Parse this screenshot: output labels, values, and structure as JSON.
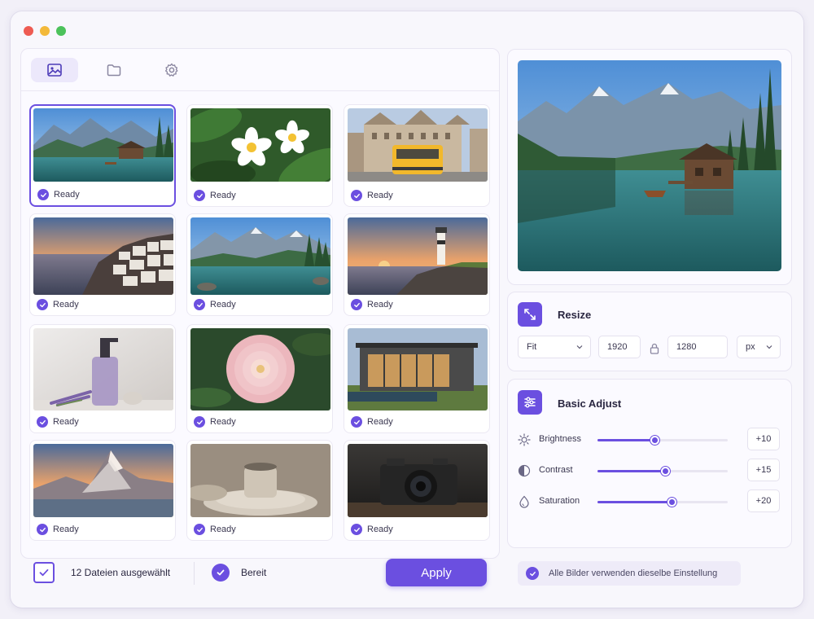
{
  "window": {
    "controls": [
      "close",
      "minimize",
      "maximize"
    ]
  },
  "tabs": [
    {
      "name": "image-icon",
      "active": true
    },
    {
      "name": "folder-icon",
      "active": false
    },
    {
      "name": "gear-icon",
      "active": false
    }
  ],
  "gallery": {
    "items": [
      {
        "scene": "mountain-lake-cabin",
        "status": "Ready",
        "selected": true
      },
      {
        "scene": "frangipani-flowers",
        "status": "Ready",
        "selected": false
      },
      {
        "scene": "yellow-tram-city",
        "status": "Ready",
        "selected": false
      },
      {
        "scene": "coastal-village-sunset",
        "status": "Ready",
        "selected": false
      },
      {
        "scene": "alpine-lake-reflection",
        "status": "Ready",
        "selected": false
      },
      {
        "scene": "lighthouse-sunset",
        "status": "Ready",
        "selected": false
      },
      {
        "scene": "soap-bottle-lavender",
        "status": "Ready",
        "selected": false
      },
      {
        "scene": "pink-dahlia",
        "status": "Ready",
        "selected": false
      },
      {
        "scene": "modern-house-pool",
        "status": "Ready",
        "selected": false
      },
      {
        "scene": "matterhorn-peak",
        "status": "Ready",
        "selected": false
      },
      {
        "scene": "ceramic-cup",
        "status": "Ready",
        "selected": false
      },
      {
        "scene": "vintage-camera",
        "status": "Ready",
        "selected": false
      }
    ]
  },
  "footer": {
    "selected_count": "12 Dateien ausgewählt",
    "ready_label": "Bereit",
    "apply_label": "Apply"
  },
  "resize": {
    "title": "Resize",
    "mode": "Fit",
    "width": "1920",
    "height": "1280",
    "unit": "px"
  },
  "adjust": {
    "title": "Basic Adjust",
    "rows": [
      {
        "label": "Brightness",
        "value": "+10",
        "level": 0.44,
        "icon": "sun-icon"
      },
      {
        "label": "Contrast",
        "value": "+15",
        "level": 0.52,
        "icon": "contrast-icon"
      },
      {
        "label": "Saturation",
        "value": "+20",
        "level": 0.57,
        "icon": "droplet-icon"
      }
    ]
  },
  "apply_all_label": "Alle Bilder verwenden dieselbe Einstellung",
  "colors": {
    "accent": "#6b4fe0",
    "background": "#f8f7fc"
  }
}
